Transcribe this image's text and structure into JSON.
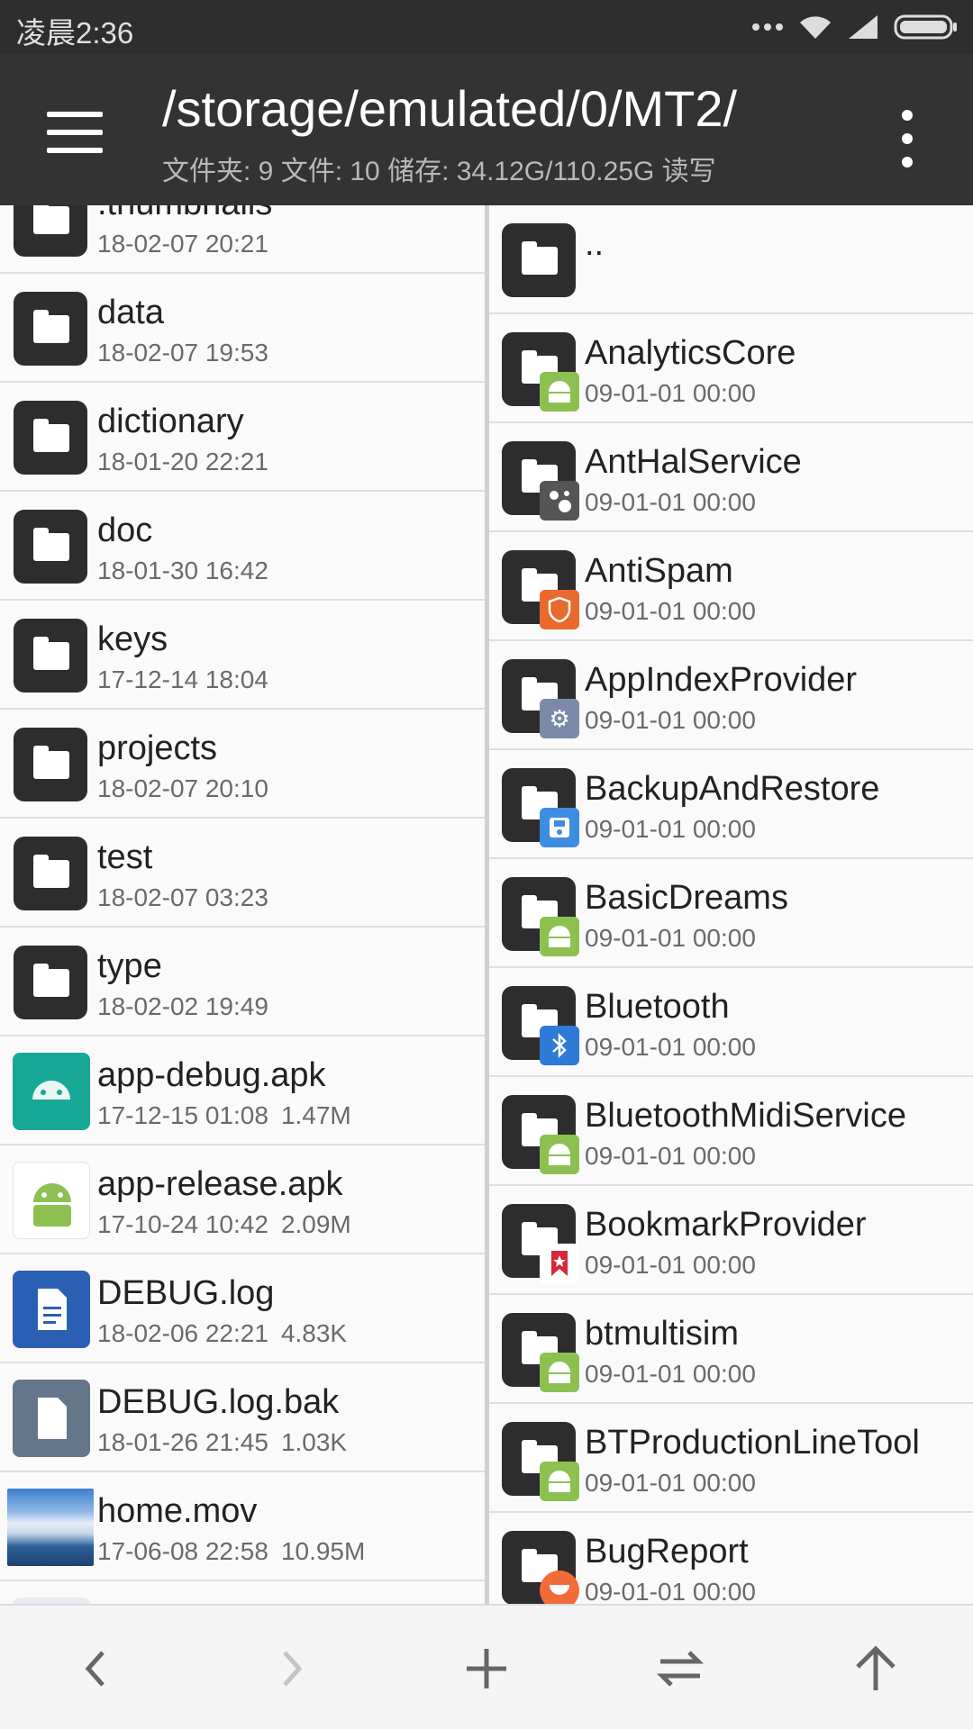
{
  "status_bar": {
    "time": "凌晨2:36",
    "icons": [
      "more-dots-icon",
      "wifi-icon",
      "signal-icon",
      "battery-icon"
    ]
  },
  "header": {
    "path": "/storage/emulated/0/MT2/",
    "info": "文件夹: 9  文件: 10  储存: 34.12G/110.25G  读写",
    "menu_icon": "hamburger-menu-icon",
    "more_icon": "overflow-menu-icon"
  },
  "left_pane": {
    "items": [
      {
        "name": ".thumbnails",
        "date": "18-02-07 20:21",
        "size": "",
        "type": "folder"
      },
      {
        "name": "data",
        "date": "18-02-07 19:53",
        "size": "",
        "type": "folder"
      },
      {
        "name": "dictionary",
        "date": "18-01-20 22:21",
        "size": "",
        "type": "folder"
      },
      {
        "name": "doc",
        "date": "18-01-30 16:42",
        "size": "",
        "type": "folder"
      },
      {
        "name": "keys",
        "date": "17-12-14 18:04",
        "size": "",
        "type": "folder"
      },
      {
        "name": "projects",
        "date": "18-02-07 20:10",
        "size": "",
        "type": "folder"
      },
      {
        "name": "test",
        "date": "18-02-07 03:23",
        "size": "",
        "type": "folder"
      },
      {
        "name": "type",
        "date": "18-02-02 19:49",
        "size": "",
        "type": "folder"
      },
      {
        "name": "app-debug.apk",
        "date": "17-12-15 01:08",
        "size": "1.47M",
        "type": "apk-debug"
      },
      {
        "name": "app-release.apk",
        "date": "17-10-24 10:42",
        "size": "2.09M",
        "type": "apk-release"
      },
      {
        "name": "DEBUG.log",
        "date": "18-02-06 22:21",
        "size": "4.83K",
        "type": "doc"
      },
      {
        "name": "DEBUG.log.bak",
        "date": "18-01-26 21:45",
        "size": "1.03K",
        "type": "doc2"
      },
      {
        "name": "home.mov",
        "date": "17-06-08 22:58",
        "size": "10.95M",
        "type": "video"
      }
    ]
  },
  "right_pane": {
    "items": [
      {
        "name": "..",
        "date": "",
        "badge": ""
      },
      {
        "name": "AnalyticsCore",
        "date": "09-01-01 00:00",
        "badge": "android-icon",
        "badge_color": "#8cc152"
      },
      {
        "name": "AntHalService",
        "date": "09-01-01 00:00",
        "badge": "share-nodes-icon",
        "badge_color": "#555555"
      },
      {
        "name": "AntiSpam",
        "date": "09-01-01 00:00",
        "badge": "shield-icon",
        "badge_color": "#e86a2c"
      },
      {
        "name": "AppIndexProvider",
        "date": "09-01-01 00:00",
        "badge": "gear-icon",
        "badge_color": "#7a8aa8"
      },
      {
        "name": "BackupAndRestore",
        "date": "09-01-01 00:00",
        "badge": "floppy-icon",
        "badge_color": "#3d8ee0"
      },
      {
        "name": "BasicDreams",
        "date": "09-01-01 00:00",
        "badge": "android-icon",
        "badge_color": "#8cc152"
      },
      {
        "name": "Bluetooth",
        "date": "09-01-01 00:00",
        "badge": "bluetooth-icon",
        "badge_color": "#2f7ad6"
      },
      {
        "name": "BluetoothMidiService",
        "date": "09-01-01 00:00",
        "badge": "android-icon",
        "badge_color": "#8cc152"
      },
      {
        "name": "BookmarkProvider",
        "date": "09-01-01 00:00",
        "badge": "bookmark-icon",
        "badge_color": "#d7283a"
      },
      {
        "name": "btmultisim",
        "date": "09-01-01 00:00",
        "badge": "android-icon",
        "badge_color": "#8cc152"
      },
      {
        "name": "BTProductionLineTool",
        "date": "09-01-01 00:00",
        "badge": "android-icon",
        "badge_color": "#8cc152"
      },
      {
        "name": "BugReport",
        "date": "09-01-01 00:00",
        "badge": "bug-report-icon",
        "badge_color": "#f26b3a"
      }
    ]
  },
  "bottom_bar": {
    "buttons": [
      "back-icon",
      "forward-icon",
      "add-icon",
      "swap-icon",
      "up-icon"
    ]
  }
}
